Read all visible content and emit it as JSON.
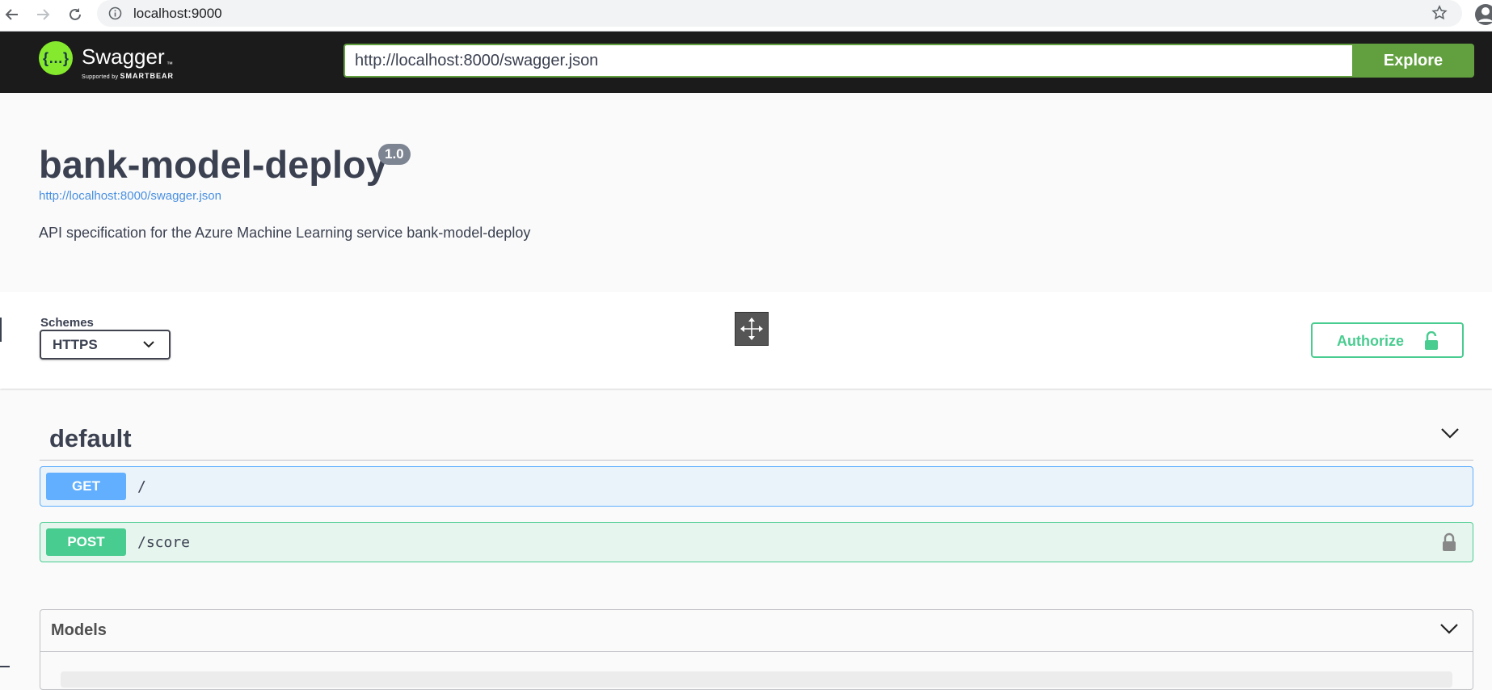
{
  "browser": {
    "address": "localhost:9000"
  },
  "topbar": {
    "logo_text": "Swagger",
    "logo_tm": "™",
    "logo_supported_by": "Supported by",
    "logo_smartbear": "SMARTBEAR",
    "spec_url": "http://localhost:8000/swagger.json",
    "explore_label": "Explore",
    "accent_color": "#62a03f"
  },
  "info": {
    "title": "bank-model-deploy",
    "version": "1.0",
    "url": "http://localhost:8000/swagger.json",
    "description": "API specification for the Azure Machine Learning service bank-model-deploy"
  },
  "schemes": {
    "label": "Schemes",
    "selected": "HTTPS",
    "authorize_label": "Authorize"
  },
  "tag": {
    "name": "default"
  },
  "operations": [
    {
      "method": "GET",
      "path": "/",
      "color": "#61affe"
    },
    {
      "method": "POST",
      "path": "/score",
      "color": "#49cc90"
    }
  ],
  "models": {
    "title": "Models"
  }
}
